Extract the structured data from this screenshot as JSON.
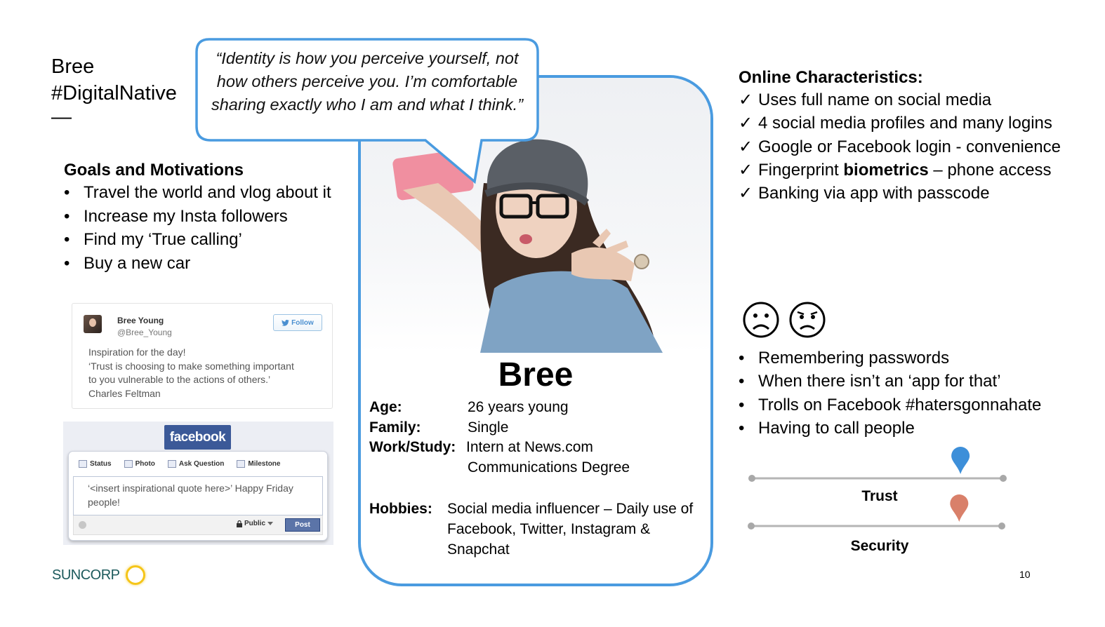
{
  "title": {
    "name": "Bree",
    "hashtag": "#DigitalNative",
    "dash": "—"
  },
  "quote": "“Identity is how you perceive yourself, not how others perceive you.  I’m comfortable sharing exactly who I am and what I think.”",
  "goals": {
    "heading": "Goals and Motivations",
    "items": [
      "Travel the world and vlog about it",
      "Increase my Insta followers",
      "Find my ‘True calling’",
      "Buy a new car"
    ]
  },
  "tweet": {
    "name": "Bree Young",
    "handle": "@Bree_Young",
    "follow_label": "Follow",
    "lines": [
      "Inspiration for the day!",
      "‘Trust is choosing to make something important",
      "to you vulnerable to the actions of others.’",
      "Charles Feltman"
    ]
  },
  "facebook": {
    "logo": "facebook",
    "tabs": [
      "Status",
      "Photo",
      "Ask Question",
      "Milestone"
    ],
    "compose_text": "‘<insert inspirational quote here>’  Happy Friday people!",
    "privacy_label": "Public",
    "post_label": "Post"
  },
  "brand": {
    "name": "SUNCORP",
    "color": "#1c5a5c"
  },
  "profile": {
    "name": "Bree",
    "details": [
      {
        "label": "Age:",
        "value": "26 years young"
      },
      {
        "label": "Family:",
        "value": "Single"
      },
      {
        "label": "Work/Study:",
        "value": "Intern at News.com"
      },
      {
        "label": "",
        "value": "Communications Degree"
      }
    ],
    "hobbies_label": "Hobbies:",
    "hobbies_value": "Social media influencer – Daily use of Facebook, Twitter, Instagram & Snapchat",
    "border_color": "#4a9be0"
  },
  "online": {
    "heading": "Online Characteristics:",
    "check": "✓",
    "items": [
      {
        "pre": "Uses full name on social media",
        "bold": "",
        "post": ""
      },
      {
        "pre": "4 social media profiles and many logins",
        "bold": "",
        "post": ""
      },
      {
        "pre": "Google or Facebook login - convenience",
        "bold": "",
        "post": ""
      },
      {
        "pre": "Fingerprint ",
        "bold": "biometrics",
        "post": " – phone access"
      },
      {
        "pre": "Banking via app with passcode",
        "bold": "",
        "post": ""
      }
    ]
  },
  "faces": [
    "sad-face-icon",
    "annoyed-face-icon"
  ],
  "pains": [
    "Remembering passwords",
    "When there isn’t an ‘app for that’",
    "Trolls on Facebook #hatersgonnahate",
    "Having to call people"
  ],
  "sliders": [
    {
      "label": "Trust",
      "value": 0.83,
      "marker_color": "#3d8fd9"
    },
    {
      "label": "Security",
      "value": 0.83,
      "marker_color": "#d9806a"
    }
  ],
  "page_number": "10"
}
